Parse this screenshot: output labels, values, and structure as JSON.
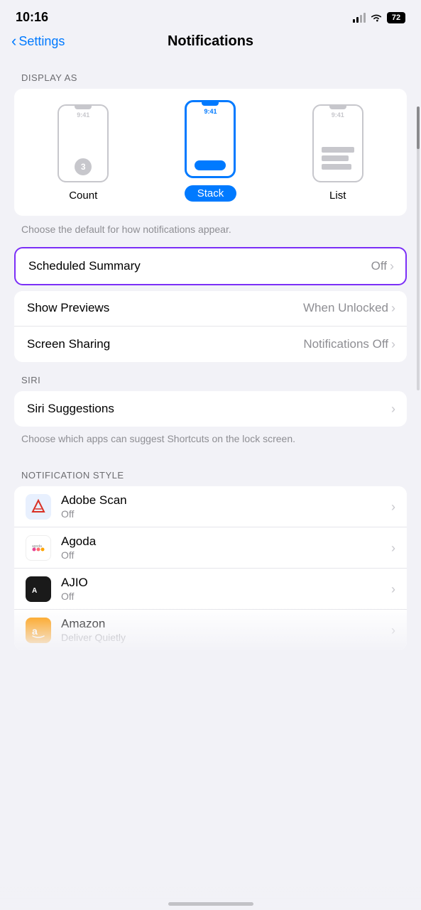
{
  "statusBar": {
    "time": "10:16",
    "battery": "72"
  },
  "nav": {
    "back": "Settings",
    "title": "Notifications"
  },
  "displayAs": {
    "sectionLabel": "DISPLAY AS",
    "options": [
      {
        "label": "Count",
        "type": "count"
      },
      {
        "label": "Stack",
        "type": "stack",
        "selected": true
      },
      {
        "label": "List",
        "type": "list"
      }
    ],
    "helperText": "Choose the default for how notifications appear."
  },
  "rows": {
    "scheduledSummary": {
      "label": "Scheduled Summary",
      "value": "Off"
    },
    "showPreviews": {
      "label": "Show Previews",
      "value": "When Unlocked"
    },
    "screenSharing": {
      "label": "Screen Sharing",
      "value": "Notifications Off"
    }
  },
  "siri": {
    "sectionLabel": "SIRI",
    "suggestionLabel": "Siri Suggestions",
    "helperText": "Choose which apps can suggest Shortcuts on the lock screen."
  },
  "notificationStyle": {
    "sectionLabel": "NOTIFICATION STYLE",
    "apps": [
      {
        "name": "Adobe Scan",
        "status": "Off",
        "iconType": "adobe"
      },
      {
        "name": "Agoda",
        "status": "Off",
        "iconType": "agoda"
      },
      {
        "name": "AJIO",
        "status": "Off",
        "iconType": "ajio"
      },
      {
        "name": "Amazon",
        "status": "Deliver Quietly",
        "iconType": "amazon"
      }
    ]
  }
}
